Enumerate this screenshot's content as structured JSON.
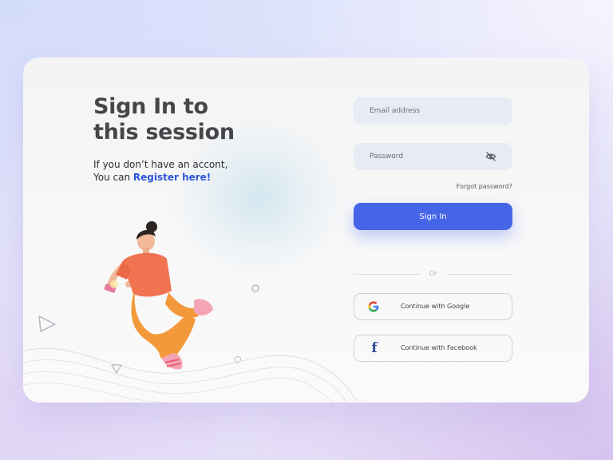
{
  "heading": {
    "line1": "Sign In to",
    "line2": "this session"
  },
  "subtitle": {
    "line1": "If you don’t have an accont,",
    "line2_prefix": "You can ",
    "register_link": "Register here!"
  },
  "form": {
    "email": {
      "placeholder": "Email address",
      "value": ""
    },
    "password": {
      "placeholder": "Password",
      "value": "",
      "toggle_icon": "eye-off-icon"
    },
    "forgot_password": "Forgot password?",
    "sign_in_label": "Sign In"
  },
  "divider_label": "Or",
  "social": {
    "google": {
      "label": "Continue with Google",
      "icon": "google-icon"
    },
    "facebook": {
      "label": "Continue with Facebook",
      "icon": "facebook-icon",
      "glyph": "f"
    }
  },
  "illustration": "person-floating-illustration",
  "colors": {
    "primary": "#4565e7",
    "link": "#2d55d8",
    "heading": "#46464a",
    "input_bg": "#e7ebf3",
    "facebook": "#2f4a9a"
  }
}
